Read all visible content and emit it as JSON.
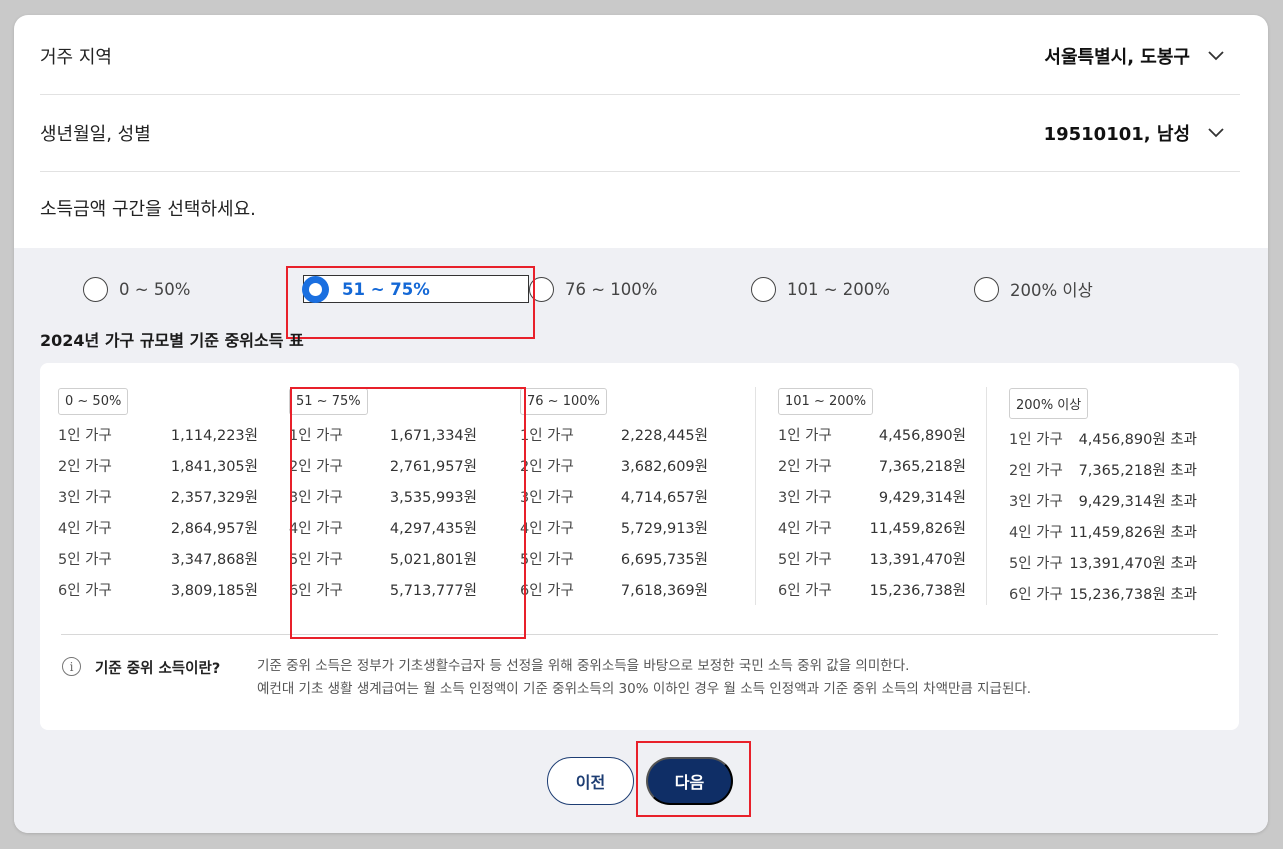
{
  "region": {
    "label": "거주 지역",
    "value": "서울특별시, 도봉구"
  },
  "birth": {
    "label": "생년월일, 성별",
    "value": "19510101, 남성"
  },
  "question": "소득금액 구간을 선택하세요.",
  "options": [
    {
      "label": "0 ~ 50%",
      "selected": false
    },
    {
      "label": "51 ~ 75%",
      "selected": true
    },
    {
      "label": "76 ~ 100%",
      "selected": false
    },
    {
      "label": "101 ~ 200%",
      "selected": false
    },
    {
      "label": "200% 이상",
      "selected": false
    }
  ],
  "table_title": "2024년 가구 규모별 기준 중위소득 표",
  "columns": [
    {
      "tag": "0 ~ 50%",
      "rows": [
        {
          "k": "1인 가구",
          "v": "1,114,223원"
        },
        {
          "k": "2인 가구",
          "v": "1,841,305원"
        },
        {
          "k": "3인 가구",
          "v": "2,357,329원"
        },
        {
          "k": "4인 가구",
          "v": "2,864,957원"
        },
        {
          "k": "5인 가구",
          "v": "3,347,868원"
        },
        {
          "k": "6인 가구",
          "v": "3,809,185원"
        }
      ]
    },
    {
      "tag": "51 ~ 75%",
      "rows": [
        {
          "k": "1인 가구",
          "v": "1,671,334원"
        },
        {
          "k": "2인 가구",
          "v": "2,761,957원"
        },
        {
          "k": "3인 가구",
          "v": "3,535,993원"
        },
        {
          "k": "4인 가구",
          "v": "4,297,435원"
        },
        {
          "k": "5인 가구",
          "v": "5,021,801원"
        },
        {
          "k": "6인 가구",
          "v": "5,713,777원"
        }
      ]
    },
    {
      "tag": "76 ~ 100%",
      "rows": [
        {
          "k": "1인 가구",
          "v": "2,228,445원"
        },
        {
          "k": "2인 가구",
          "v": "3,682,609원"
        },
        {
          "k": "3인 가구",
          "v": "4,714,657원"
        },
        {
          "k": "4인 가구",
          "v": "5,729,913원"
        },
        {
          "k": "5인 가구",
          "v": "6,695,735원"
        },
        {
          "k": "6인 가구",
          "v": "7,618,369원"
        }
      ]
    },
    {
      "tag": "101 ~ 200%",
      "rows": [
        {
          "k": "1인 가구",
          "v": "4,456,890원"
        },
        {
          "k": "2인 가구",
          "v": "7,365,218원"
        },
        {
          "k": "3인 가구",
          "v": "9,429,314원"
        },
        {
          "k": "4인 가구",
          "v": "11,459,826원"
        },
        {
          "k": "5인 가구",
          "v": "13,391,470원"
        },
        {
          "k": "6인 가구",
          "v": "15,236,738원"
        }
      ]
    },
    {
      "tag": "200% 이상",
      "rows": [
        {
          "k": "1인 가구",
          "v": "4,456,890원 초과"
        },
        {
          "k": "2인 가구",
          "v": "7,365,218원 초과"
        },
        {
          "k": "3인 가구",
          "v": "9,429,314원 초과"
        },
        {
          "k": "4인 가구",
          "v": "11,459,826원 초과"
        },
        {
          "k": "5인 가구",
          "v": "13,391,470원 초과"
        },
        {
          "k": "6인 가구",
          "v": "15,236,738원 초과"
        }
      ]
    }
  ],
  "info": {
    "icon": "i",
    "title": "기준 중위 소득이란?",
    "line1": "기준 중위 소득은 정부가 기초생활수급자 등 선정을 위해 중위소득을 바탕으로 보정한 국민 소득 중위 값을 의미한다.",
    "line2": "예컨대 기초 생활 생계급여는 월 소득 인정액이 기준 중위소득의 30% 이하인 경우 월 소득 인정액과 기준 중위 소득의 차액만큼 지급된다."
  },
  "buttons": {
    "prev": "이전",
    "next": "다음"
  },
  "colors": {
    "accent": "#1a6fe0",
    "primary": "#0f2e66",
    "highlight": "#e8202a"
  }
}
